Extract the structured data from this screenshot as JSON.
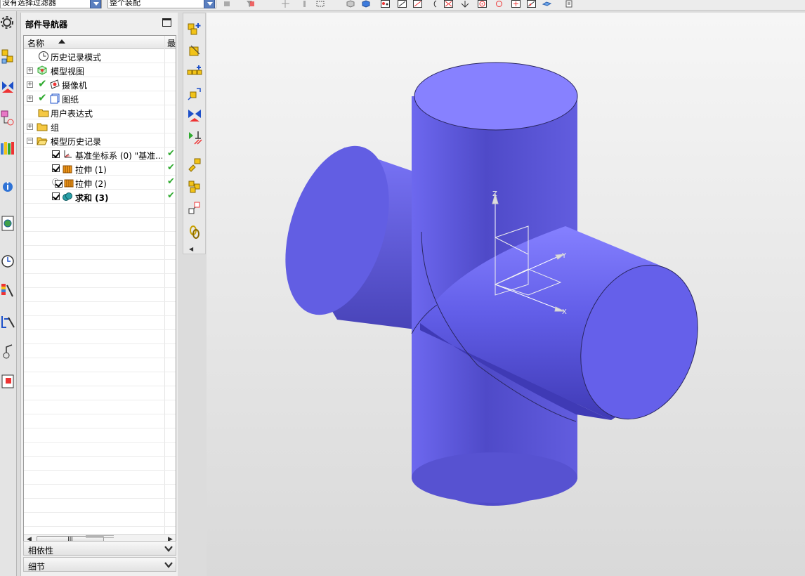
{
  "toolbar": {
    "filter_value": "没有选择过滤器",
    "scope_value": "整个装配"
  },
  "navigator": {
    "title": "部件导航器",
    "column_name": "名称",
    "column_2": "最",
    "rows": [
      {
        "label": "历史记录模式",
        "icon": "clock-icon"
      },
      {
        "label": "模型视图",
        "icon": "model-views-icon"
      },
      {
        "label": "摄像机",
        "icon": "camera-icon"
      },
      {
        "label": "图纸",
        "icon": "drawing-sheet-icon"
      },
      {
        "label": "用户表达式",
        "icon": "folder-icon"
      },
      {
        "label": "组",
        "icon": "folder-icon"
      },
      {
        "label": "模型历史记录",
        "icon": "open-folder-icon"
      },
      {
        "label": "基准坐标系 (0) \"基准...",
        "icon": "datum-csys-icon"
      },
      {
        "label": "拉伸 (1)",
        "icon": "extrude-icon"
      },
      {
        "label": "拉伸 (2)",
        "icon": "extrude-icon"
      },
      {
        "label": "求和 (3)",
        "icon": "unite-icon"
      }
    ],
    "scroll_thumb": "III",
    "sections": [
      {
        "label": "相依性"
      },
      {
        "label": "细节"
      }
    ]
  },
  "viewport": {
    "axis_labels": {
      "z": "Z",
      "y": "Y",
      "x": "X"
    },
    "colors": {
      "body": "#6f6cf0",
      "body_dark": "#4a46c4",
      "cap": "#8481ff"
    }
  }
}
